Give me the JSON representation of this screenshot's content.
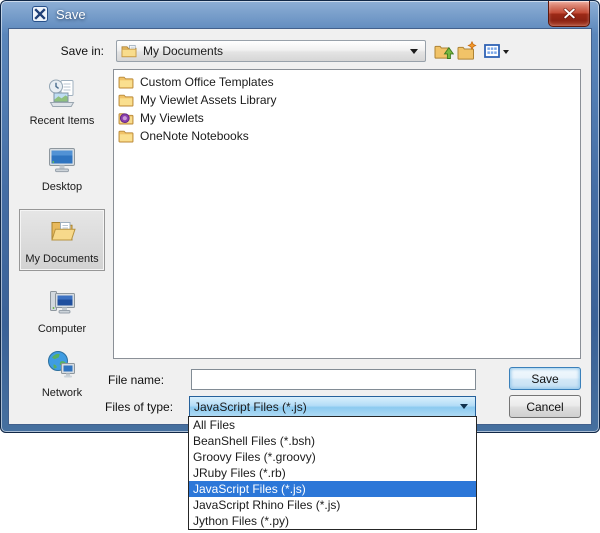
{
  "window": {
    "title": "Save"
  },
  "location_bar": {
    "label": "Save in:",
    "value": "My Documents"
  },
  "sidebar": {
    "items": [
      {
        "label": "Recent Items",
        "icon": "recent-items-icon",
        "selected": false
      },
      {
        "label": "Desktop",
        "icon": "desktop-icon",
        "selected": false
      },
      {
        "label": "My Documents",
        "icon": "my-documents-icon",
        "selected": true
      },
      {
        "label": "Computer",
        "icon": "computer-icon",
        "selected": false
      },
      {
        "label": "Network",
        "icon": "network-icon",
        "selected": false
      }
    ]
  },
  "file_list": {
    "items": [
      {
        "label": "Custom Office Templates",
        "icon": "folder-icon"
      },
      {
        "label": "My Viewlet Assets Library",
        "icon": "folder-icon"
      },
      {
        "label": "My Viewlets",
        "icon": "viewlet-folder-icon"
      },
      {
        "label": "OneNote Notebooks",
        "icon": "folder-icon"
      }
    ]
  },
  "form": {
    "file_name_label": "File name:",
    "file_name_value": "",
    "files_of_type_label": "Files of type:",
    "files_of_type_value": "JavaScript Files (*.js)"
  },
  "buttons": {
    "save": "Save",
    "cancel": "Cancel"
  },
  "type_dropdown": {
    "selected_index": 4,
    "options": [
      "All Files",
      "BeanShell Files (*.bsh)",
      "Groovy Files (*.groovy)",
      "JRuby Files (*.rb)",
      "JavaScript Files (*.js)",
      "JavaScript Rhino Files (*.js)",
      "Jython Files (*.py)"
    ]
  },
  "icons": {
    "titlebar_app": "viewlet-app-icon",
    "titlebar_close": "close-icon",
    "toolbar_up": "up-one-level-icon",
    "toolbar_new_folder": "create-new-folder-icon",
    "toolbar_view": "view-menu-icon",
    "combo_arrow": "chevron-down-icon"
  },
  "colors": {
    "titlebar_blue": "#44699f",
    "close_red": "#c24a35",
    "selection_blue": "#2c77d8",
    "combo_open_blue": "#8ccaf0",
    "folder_yellow": "#f1c368",
    "dialog_bg": "#f0f0f0"
  }
}
